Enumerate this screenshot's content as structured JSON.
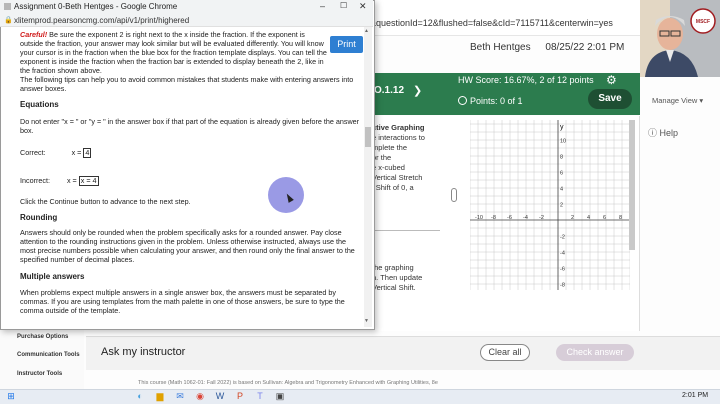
{
  "popup": {
    "window_title": "Assignment 0-Beth Hentges - Google Chrome",
    "url": "xlitemprod.pearsoncmg.com/api/v1/print/highered",
    "print_label": "Print",
    "careful_label": "Careful!",
    "careful_text": " Be sure the exponent 2 is right next to the x inside the fraction. If the exponent is outside the fraction, your answer may look similar but will be evaluated differently. You will know your cursor is in the fraction when the blue box for the fraction template displays. You can tell the exponent is inside the fraction when the fraction bar is extended to display beneath the 2, like in the fraction shown above.",
    "tips_intro": "The following tips can help you to avoid common mistakes that students make with entering answers into answer boxes.",
    "equations_heading": "Equations",
    "equations_text": "Do not enter \"x = \" or \"y = \" in the answer box if that part of the equation is already given before the answer box.",
    "correct_label": "Correct:",
    "correct_prefix": "x =",
    "correct_value": "4",
    "incorrect_label": "Incorrect:",
    "incorrect_prefix": "x =",
    "incorrect_value": "x = 4",
    "continue_text": "Click the Continue button to advance to the next step.",
    "rounding_heading": "Rounding",
    "rounding_text": "Answers should only be rounded when the problem specifically asks for a rounded answer. Pay close attention to the rounding instructions given in the problem. Unless otherwise instructed, always use the most precise numbers possible when calculating your answer, and then round only the final answer to the specified number of decimal places.",
    "multiple_heading": "Multiple answers",
    "multiple_text": "When problems expect multiple answers in a single answer box, the answers must be separated by commas.  If you are using templates from the math palette in one of those answers, be sure to type the comma outside of the template."
  },
  "app": {
    "url_rest": "&questionId=12&flushed=false&cId=7115711&centerwin=yes",
    "user_name": "Beth Hentges",
    "datetime": "08/25/22 2:01 PM",
    "section_number": "O.1.12",
    "nav_chevron": "❯",
    "hw_score": "HW Score: 16.67%, 2 of 12 points",
    "points": "Points: 0 of 1",
    "save_label": "Save",
    "manage_view": "Manage View ▾",
    "help_label": "Help",
    "question_text_top": [
      "ctive Graphing",
      "e interactions to",
      "mplete the",
      "",
      "or the",
      "",
      "e x-cubed",
      "Vertical Stretch",
      "l Shift of 0, a"
    ],
    "question_text_bottom": [
      "the graphing",
      "h. Then update",
      "Vertical Shift."
    ],
    "ask_instructor": "Ask my instructor",
    "clear_all": "Clear all",
    "check_answer": "Check answer",
    "footer_note": "This course (Math 1062-01: Fall 2022) is based on Sullivan: Algebra and Trigonometry Enhanced with Graphing Utilities, 8e"
  },
  "sidebar": {
    "items": [
      "Purchase Options",
      "Communication Tools",
      "Instructor Tools"
    ]
  },
  "graph": {
    "x_label": "x",
    "y_label": "y",
    "y_ticks": [
      "10",
      "8",
      "6",
      "4",
      "2",
      "-2",
      "-4",
      "-6",
      "-8"
    ],
    "x_ticks": [
      "-10",
      "-8",
      "-6",
      "-4",
      "-2",
      "2",
      "4",
      "6",
      "8"
    ]
  },
  "taskbar": {
    "clock": "2:01 PM"
  },
  "webcam": {
    "logo_text": "MSCF"
  },
  "colors": {
    "header_green": "#2c7c4e",
    "save_dark": "#1e4f33",
    "print_blue": "#2e7fd2",
    "careful_red": "#d01c1c"
  }
}
